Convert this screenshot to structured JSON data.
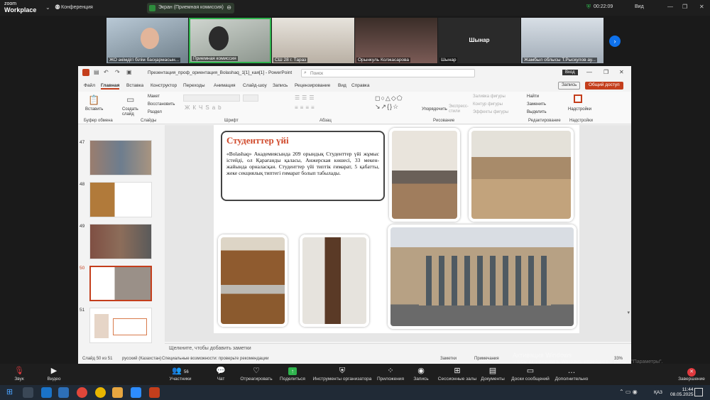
{
  "zoom": {
    "brand_line1": "zoom",
    "brand_line2": "Workplace",
    "conference_label": "Конференция",
    "screen_share_label": "Экран (Приемная комиссия)",
    "timer": "00:22:09",
    "view_label": "Вид",
    "participants": [
      {
        "name": "ЖО әкімдігі білім басқармасын..."
      },
      {
        "name": "Приемная комиссия"
      },
      {
        "name": "СШ 28 г. Тараз"
      },
      {
        "name": "Орынкуль Колжасарова"
      },
      {
        "name": "Шынар",
        "center_label": "Шынар"
      },
      {
        "name": "Жамбыл облысы Т.Рыскулов ау..."
      }
    ],
    "bottom": {
      "mute": "Звук",
      "video": "Видео",
      "participants": "Участники",
      "participants_count": "56",
      "chat": "Чат",
      "react": "Отреагировать",
      "share": "Поделиться",
      "host_tools": "Инструменты организатора",
      "apps": "Приложения",
      "record": "Запись",
      "rooms": "Сессионные залы",
      "docs": "Документы",
      "whiteboard": "Доски сообщений",
      "more": "Дополнительно",
      "end": "Завершение"
    }
  },
  "ppt": {
    "title": "Презентация_проф_ориентация_Bolashaq_1[1]_кая[1] - PowerPoint",
    "search_placeholder": "Поиск",
    "signin": "Вход",
    "tabs": [
      "Файл",
      "Главная",
      "Вставка",
      "Конструктор",
      "Переходы",
      "Анимация",
      "Слайд-шоу",
      "Запись",
      "Рецензирование",
      "Вид",
      "Справка"
    ],
    "active_tab": "Главная",
    "record_btn": "Запись",
    "share_btn": "Общий доступ",
    "ribbon": {
      "paste": "Вставить",
      "clipboard": "Буфер обмена",
      "create_slide": "Создать слайд",
      "layout": "Макет",
      "reset": "Восстановить",
      "section": "Раздел",
      "slides": "Слайды",
      "font": "Шрифт",
      "paragraph": "Абзац",
      "arrange": "Упорядочить",
      "quick_styles": "Экспресс-стили",
      "fill": "Заливка фигуры",
      "outline": "Контур фигуры",
      "effects": "Эффекты фигуры",
      "drawing": "Рисование",
      "find": "Найти",
      "replace": "Заменить",
      "select": "Выделить",
      "editing": "Редактирование",
      "addins": "Надстройки",
      "addins_group": "Надстройки"
    },
    "thumb_numbers": [
      "47",
      "48",
      "49",
      "50",
      "51"
    ],
    "slide": {
      "title": "Студенттер үйі",
      "text": "«Bolashaq» Академиясында 209 орындық Студенттер үйі жұмыс істейді, ол Қарағанды қаласы, Анжерская көшесі, 33 мекен-жайында орналасқан. Студенттер үйі типтік ғимарат, 5 қабатты, жеке секциялық типтегі ғимарат болып табылады."
    },
    "notes_placeholder": "Щелкните, чтобы добавить заметки",
    "status": {
      "slide": "Слайд 50 из 51",
      "lang": "русский (Казахстан)",
      "a11y": "Специальные возможности: проверьте рекомендации",
      "notes": "Заметки",
      "comments": "Примечания",
      "zoom": "33%"
    }
  },
  "watermark": {
    "line1": "Активация Windows",
    "line2": "Чтобы активировать Windows, перейдите в раздел \"Параметры\"."
  },
  "taskbar": {
    "lang": "ҚАЗ",
    "time": "11:44",
    "date": "08.05.2025"
  },
  "colors": {
    "accent": "#c43e1c",
    "zoom_blue": "#0e71eb",
    "title_red": "#d04a2c"
  }
}
